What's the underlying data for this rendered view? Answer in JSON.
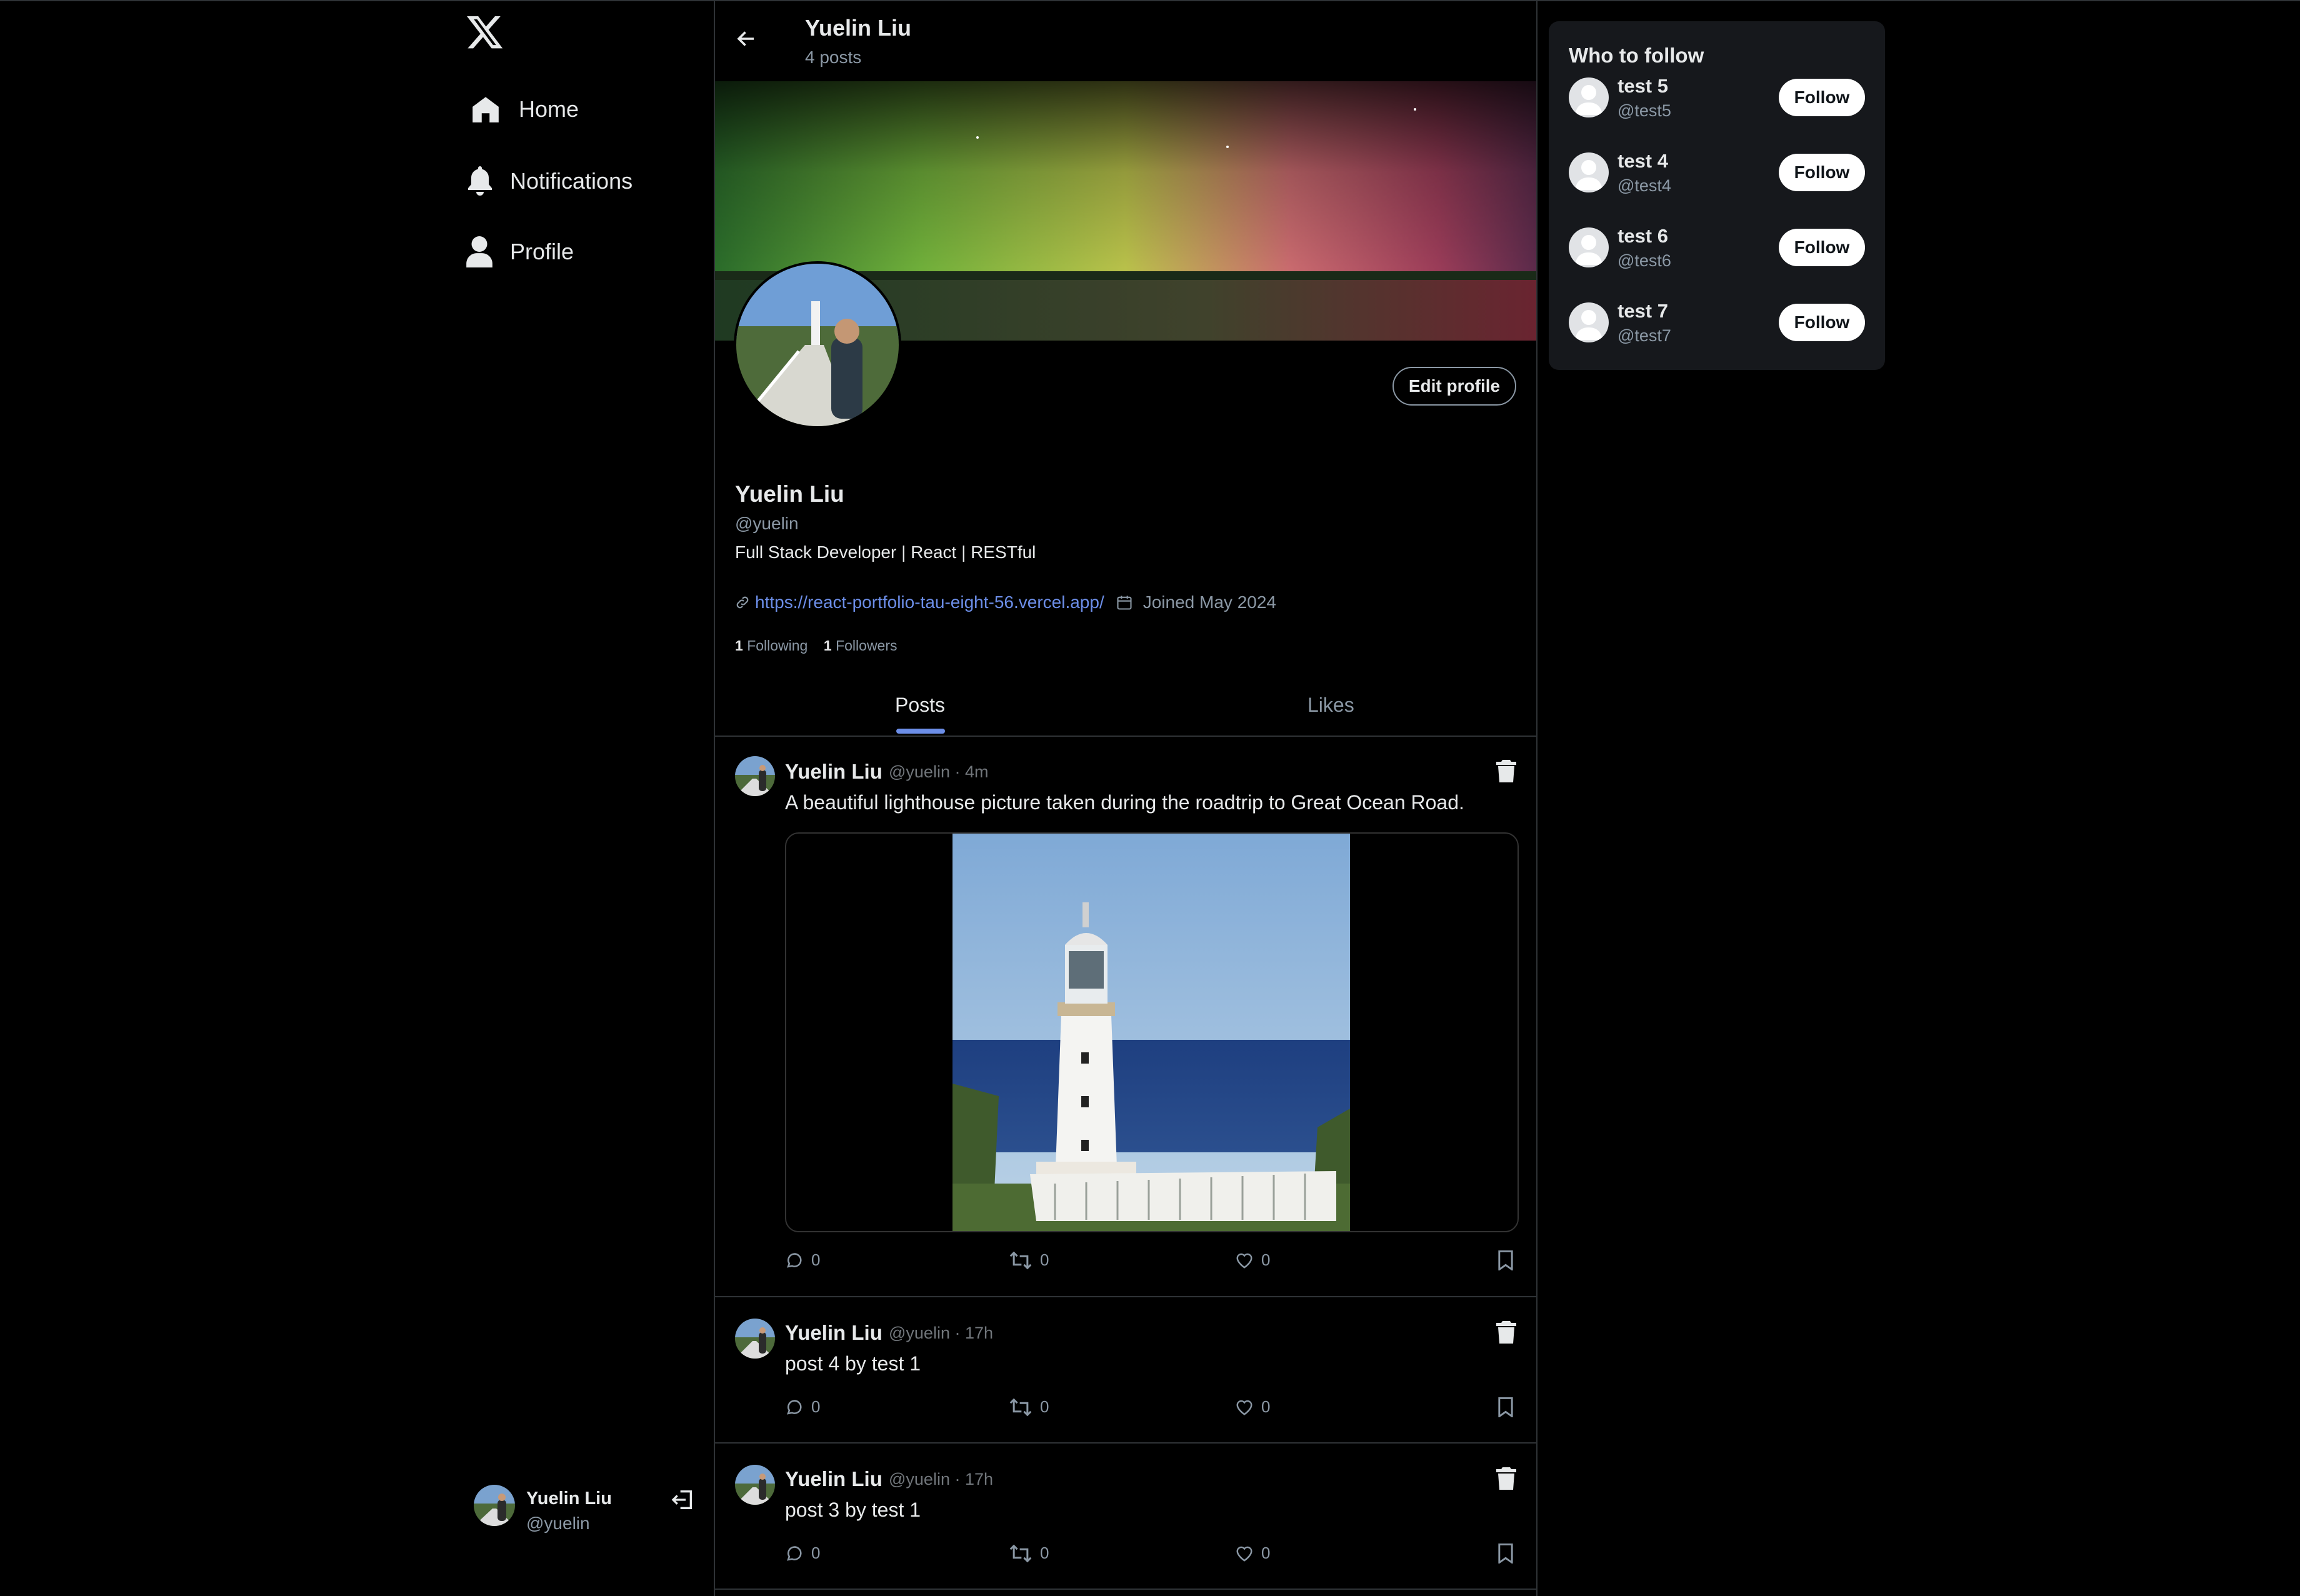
{
  "sidebar": {
    "nav": [
      {
        "label": "Home",
        "icon": "home-icon"
      },
      {
        "label": "Notifications",
        "icon": "bell-icon"
      },
      {
        "label": "Profile",
        "icon": "user-icon"
      }
    ],
    "account": {
      "name": "Yuelin Liu",
      "handle": "@yuelin"
    }
  },
  "header": {
    "name": "Yuelin Liu",
    "post_count": "4 posts"
  },
  "profile": {
    "name": "Yuelin Liu",
    "handle": "@yuelin",
    "bio": "Full Stack Developer | React | RESTful",
    "link": "https://react-portfolio-tau-eight-56.vercel.app/",
    "joined": "Joined May 2024",
    "following_count": "1",
    "following_label": "Following",
    "followers_count": "1",
    "followers_label": "Followers",
    "edit_label": "Edit profile"
  },
  "tabs": [
    {
      "label": "Posts"
    },
    {
      "label": "Likes"
    }
  ],
  "posts": [
    {
      "name": "Yuelin Liu",
      "meta": "@yuelin · 4m",
      "text": "A beautiful lighthouse picture taken during the roadtrip to Great Ocean Road.",
      "comments": "0",
      "reposts": "0",
      "likes": "0"
    },
    {
      "name": "Yuelin Liu",
      "meta": "@yuelin · 17h",
      "text": "post 4 by test 1",
      "comments": "0",
      "reposts": "0",
      "likes": "0"
    },
    {
      "name": "Yuelin Liu",
      "meta": "@yuelin · 17h",
      "text": "post 3 by test 1",
      "comments": "0",
      "reposts": "0",
      "likes": "0"
    }
  ],
  "who_to_follow": {
    "title": "Who to follow",
    "button_label": "Follow",
    "users": [
      {
        "name": "test 5",
        "handle": "@test5"
      },
      {
        "name": "test 4",
        "handle": "@test4"
      },
      {
        "name": "test 6",
        "handle": "@test6"
      },
      {
        "name": "test 7",
        "handle": "@test7"
      }
    ]
  },
  "colors": {
    "accent": "#6c8ee8",
    "background": "#000000",
    "muted": "#8b98a5"
  }
}
